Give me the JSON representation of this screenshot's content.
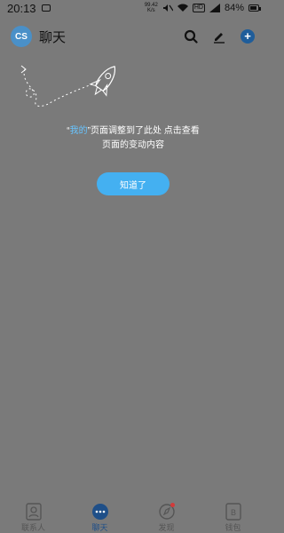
{
  "status_bar": {
    "time": "20:13",
    "net_speed_value": "99.42",
    "net_speed_unit": "K/s",
    "hd_label": "HD",
    "battery_pct": "84%",
    "battery_level": 0.84
  },
  "header": {
    "avatar_initials": "CS",
    "title": "聊天",
    "icons": [
      "search-icon",
      "edit-icon",
      "add-icon"
    ]
  },
  "guide": {
    "quote_open": "“",
    "highlight": "我的",
    "quote_close": "”",
    "line1_rest": "页面调整到了此处 点击查看",
    "line2": "页面的变动内容",
    "button_label": "知道了"
  },
  "bottom_nav": {
    "items": [
      {
        "label": "联系人",
        "icon": "contacts-icon"
      },
      {
        "label": "聊天",
        "icon": "chat-icon",
        "active": true
      },
      {
        "label": "发现",
        "icon": "discover-icon"
      },
      {
        "label": "钱包",
        "icon": "wallet-icon"
      }
    ]
  },
  "colors": {
    "overlay_bg": "#7a7a7a",
    "accent": "#44b0f1",
    "highlight": "#68c4ff",
    "avatar": "#4a90c8"
  }
}
